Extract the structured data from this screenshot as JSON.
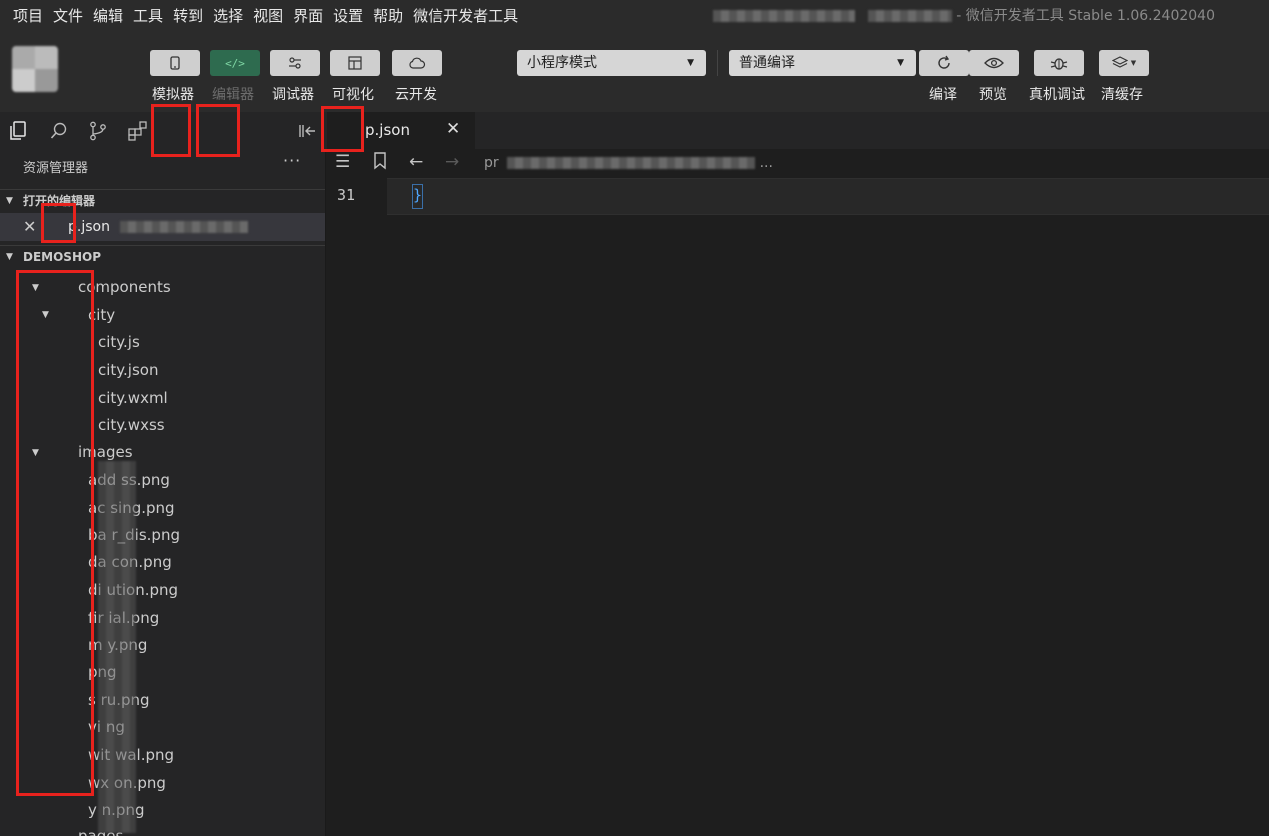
{
  "menu": [
    "项目",
    "文件",
    "编辑",
    "工具",
    "转到",
    "选择",
    "视图",
    "界面",
    "设置",
    "帮助",
    "微信开发者工具"
  ],
  "window_title": "- 微信开发者工具 Stable 1.06.2402040",
  "toolbar": {
    "left_buttons": [
      {
        "label": "模拟器",
        "icon": "phone-icon"
      },
      {
        "label": "编辑器",
        "icon": "code-icon"
      },
      {
        "label": "调试器",
        "icon": "debug-toggle-icon"
      },
      {
        "label": "可视化",
        "icon": "layout-icon"
      },
      {
        "label": "云开发",
        "icon": "cloud-icon"
      }
    ],
    "mode_select": "小程序模式",
    "compile_select": "普通编译",
    "right_buttons": [
      {
        "label": "编译",
        "icon": "refresh-icon"
      },
      {
        "label": "预览",
        "icon": "eye-icon"
      },
      {
        "label": "真机调试",
        "icon": "bug-icon"
      },
      {
        "label": "清缓存",
        "icon": "layers-icon"
      }
    ]
  },
  "tab": {
    "name": "p.json",
    "close": "✕"
  },
  "sidebar": {
    "title": "资源管理器",
    "more": "···",
    "open_editors_header": "打开的编辑器",
    "open_editor_item": "p.json",
    "project_header": "DEMOSHOP",
    "tree": [
      {
        "label": "components",
        "arrow": true
      },
      {
        "label": "city",
        "arrow": true
      },
      {
        "label": "city.js"
      },
      {
        "label": "city.json"
      },
      {
        "label": "city.wxml"
      },
      {
        "label": "city.wxss"
      },
      {
        "label": "images",
        "arrow": true
      },
      {
        "label": "add   ss.png"
      },
      {
        "label": "ac      sing.png"
      },
      {
        "label": "ba      r_dis.png"
      },
      {
        "label": "da      con.png"
      },
      {
        "label": "di      ution.png"
      },
      {
        "label": "fir      ial.png"
      },
      {
        "label": "m      y.png"
      },
      {
        "label": "       png"
      },
      {
        "label": "s      ru.png"
      },
      {
        "label": "vi      ng"
      },
      {
        "label": "wit      wal.png"
      },
      {
        "label": "wx      on.png"
      },
      {
        "label": "y       n.png"
      },
      {
        "label": "pages"
      }
    ]
  },
  "editor": {
    "breadcrumb": "pr",
    "line_number": "31",
    "code": "}"
  },
  "colors": {
    "annotation": "#e8221d",
    "accent_blue": "#4fa7ff",
    "editor_bg": "#1e1e1e"
  }
}
